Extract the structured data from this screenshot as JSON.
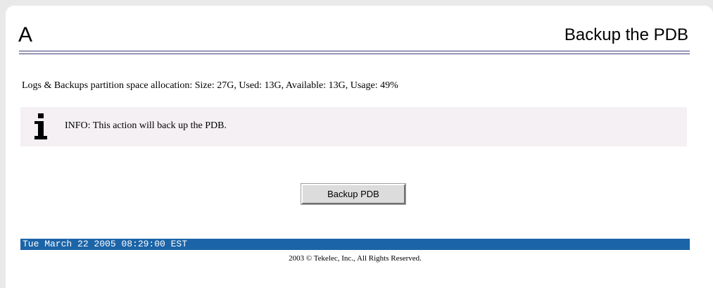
{
  "header": {
    "letter": "A",
    "title": "Backup the PDB"
  },
  "allocation": {
    "text": "Logs & Backups partition space allocation: Size: 27G, Used: 13G, Available: 13G, Usage: 49%"
  },
  "info": {
    "icon": "info-icon",
    "text": "INFO: This action will back up the PDB."
  },
  "actions": {
    "backup_label": "Backup PDB"
  },
  "status": {
    "datetime": "Tue March 22 2005 08:29:00 EST"
  },
  "footer": {
    "copyright": "2003 © Tekelec, Inc., All Rights Reserved."
  },
  "colors": {
    "status_bar": "#1c64a8",
    "info_background": "#f4f0f4",
    "rule": "#3a3a7a"
  }
}
